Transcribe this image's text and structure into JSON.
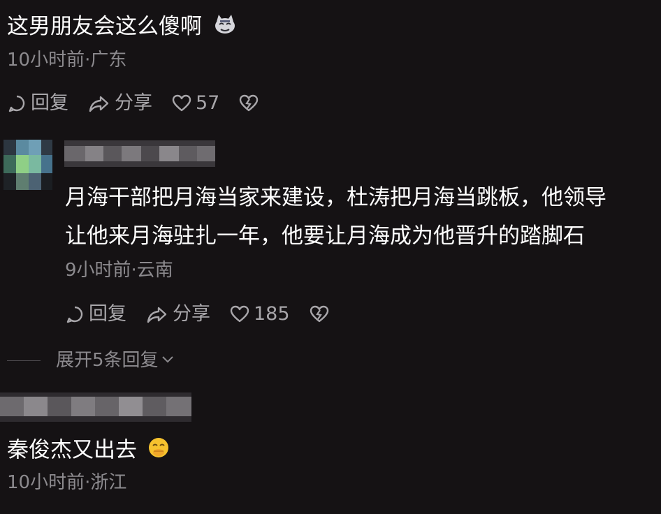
{
  "comments": [
    {
      "text": "这男朋友会这么傻啊",
      "emoji": "cat-face-emoji",
      "meta": "10小时前·广东",
      "actions": {
        "reply": "回复",
        "share": "分享",
        "likes": "57"
      }
    },
    {
      "line1": "月海干部把月海当家来建设，杜涛把月海当跳板，他领导",
      "line2": "让他来月海驻扎一年，他要让月海成为他晋升的踏脚石",
      "meta": "9小时前·云南",
      "actions": {
        "reply": "回复",
        "share": "分享",
        "likes": "185"
      },
      "expand": "展开5条回复"
    },
    {
      "text": "秦俊杰又出去",
      "emoji": "face-with-hand-over-mouth-emoji",
      "meta": "10小时前·浙江"
    }
  ],
  "colors": {
    "background": "#151214",
    "primary_text": "#ffffff",
    "secondary_text": "#8c8a8e",
    "action_text": "#a8a6aa"
  }
}
